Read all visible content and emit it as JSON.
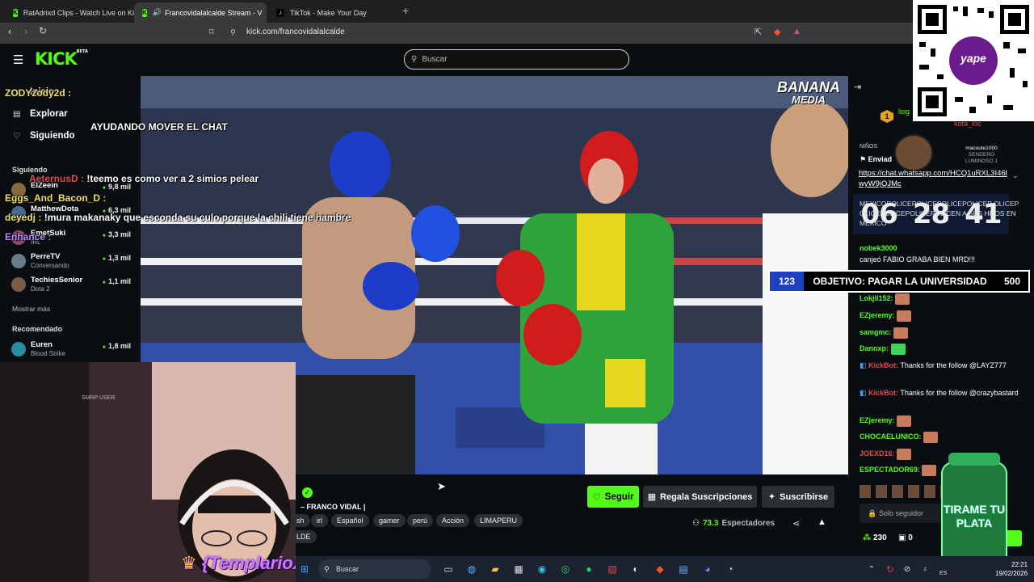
{
  "browser": {
    "tabs": [
      {
        "title": "RatAdrixd Clips - Watch Live on Kick",
        "active": false
      },
      {
        "title": "Francovidalalcalde Stream - V",
        "active": true
      },
      {
        "title": "TikTok - Make Your Day",
        "active": false
      }
    ],
    "url": "kick.com/francovidalalcalde"
  },
  "header": {
    "logo": "KICK",
    "logo_badge": "BETA",
    "search_placeholder": "Buscar"
  },
  "sidebar": {
    "nav": [
      {
        "label": "Inicio",
        "icon": "home-icon"
      },
      {
        "label": "Explorar",
        "icon": "compass-icon"
      },
      {
        "label": "Siguiendo",
        "icon": "heart-icon"
      }
    ],
    "following_header": "Siguiendo",
    "following": [
      {
        "name": "ElZeein",
        "category": "",
        "viewers": "9,8 mil"
      },
      {
        "name": "MatthewDota",
        "category": "",
        "viewers": "6,3 mil"
      },
      {
        "name": "EmetSuki",
        "category": "IRL",
        "viewers": "3,3 mil"
      },
      {
        "name": "PerreTV",
        "category": "Conversando",
        "viewers": "1,3 mil"
      },
      {
        "name": "TechiesSenior",
        "category": "Dota 2",
        "viewers": "1,1 mil"
      }
    ],
    "show_more": "Mostrar más",
    "recommended_header": "Recomendado",
    "recommended": [
      {
        "name": "Euren",
        "category": "Blood Strike",
        "viewers": "1,8 mil"
      }
    ]
  },
  "overlay": {
    "user1": "ZODYzody2d :",
    "helper_text": "AYUDANDO MOVER EL CHAT",
    "user2": "AeternusD :",
    "msg2": "!teemo es como ver a 2 simios pelear",
    "user3": "Eggs_And_Bacon_D :",
    "user4": "deyedj :",
    "msg4": "!mura makanaky que esconda su culo porque la chili tiene hambre",
    "user5": "Enhance :",
    "webcam_user": "SMRP USER",
    "templario": "{TemplarioX}",
    "banana_line1": "BANANA",
    "banana_line2": "MEDIA"
  },
  "stream_info": {
    "title": "– FRANCO VIDAL |",
    "tags": [
      "sh",
      "irl",
      "Español",
      "gamer",
      "perú",
      "Acción",
      "LIMAPERU"
    ],
    "tag2": "LDE",
    "follow_label": "Seguir",
    "gift_label": "Regala Suscripciones",
    "subscribe_label": "Suscribirse",
    "viewers": "73.3",
    "viewers_label": "Espectadores"
  },
  "chat": {
    "pinned_user": "kota_loc",
    "top_user": "liog",
    "sent_label": "Enviad",
    "niveos": "NIÑOS",
    "link": "https://chat.whatsapp.com/HCQ1uRXL3I46lwyW9jQJMc",
    "streamer_box_name": "macoute1000",
    "streamer_box_sub": "SENDERO LUMINOSO 1",
    "police_text": "MEXICOPOLICEPOLICEPOLICEPOLICEP OLICEPOLICEPOLICEPOLICEPOLICEN A SUS HIJOS EN MEXICO",
    "messages": [
      {
        "user": "nobek3000",
        "text": "canjeó FABIO GRABA BIEN MRD!!!"
      },
      {
        "user": "Lokjil152:",
        "text": ""
      },
      {
        "user": "EZjeremy:",
        "text": ""
      },
      {
        "user": "samgmc:",
        "text": ""
      },
      {
        "user": "Dannxp:",
        "text": ""
      },
      {
        "user": "KickBot:",
        "text": "Thanks for the follow @LAYZ777"
      },
      {
        "user": "KickBot:",
        "text": "Thanks for the follow @crazybastard"
      },
      {
        "user": "EZjeremy:",
        "text": ""
      },
      {
        "user": "CHOCAELUNICO:",
        "text": ""
      },
      {
        "user": "JOEXD16:",
        "text": ""
      },
      {
        "user": "ESPECTADOR69:",
        "text": ""
      }
    ],
    "input_placeholder": "Solo seguidor",
    "points": "230",
    "count": "0"
  },
  "goal_banner": {
    "left": "123",
    "text": "OBJETIVO: PAGAR LA UNIVERSIDAD",
    "right": "500"
  },
  "countdown": [
    "06",
    "28",
    "41"
  ],
  "tirame": "TIRAME TU PLATA",
  "qr_label": "yape",
  "taskbar": {
    "search": "Buscar",
    "time": "22:21",
    "date": "19/02/2026",
    "lang": "ES"
  },
  "colors": {
    "kick_green": "#53fc18",
    "chat_bg": "#0b0e11",
    "goal_blue": "#1e3fbf"
  }
}
